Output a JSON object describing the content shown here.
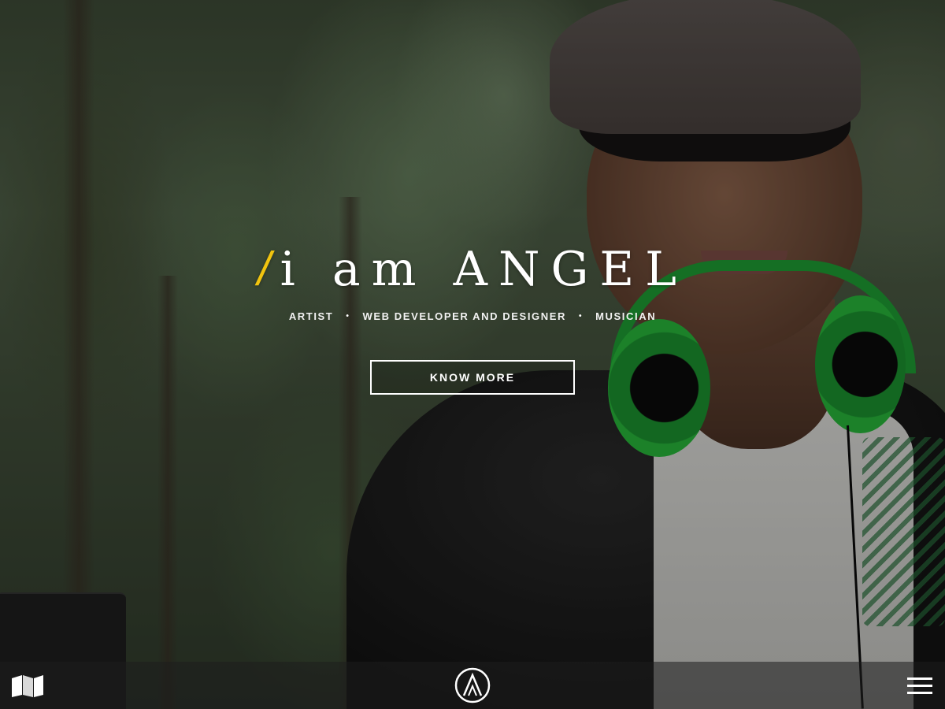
{
  "hero": {
    "headline_prefix": "/",
    "headline": "i am ANGEL",
    "roles": [
      "ARTIST",
      "WEB DEVELOPER AND DESIGNER",
      "MUSICIAN"
    ],
    "role_separator": "•",
    "cta_label": "KNOW MORE"
  },
  "bottom_bar": {
    "left_icon": "map-icon",
    "center_icon": "logo-icon",
    "right_icon": "menu-icon"
  },
  "colors": {
    "accent": "#f1c40f",
    "text": "#ffffff",
    "headphone_green": "#27b33a"
  }
}
